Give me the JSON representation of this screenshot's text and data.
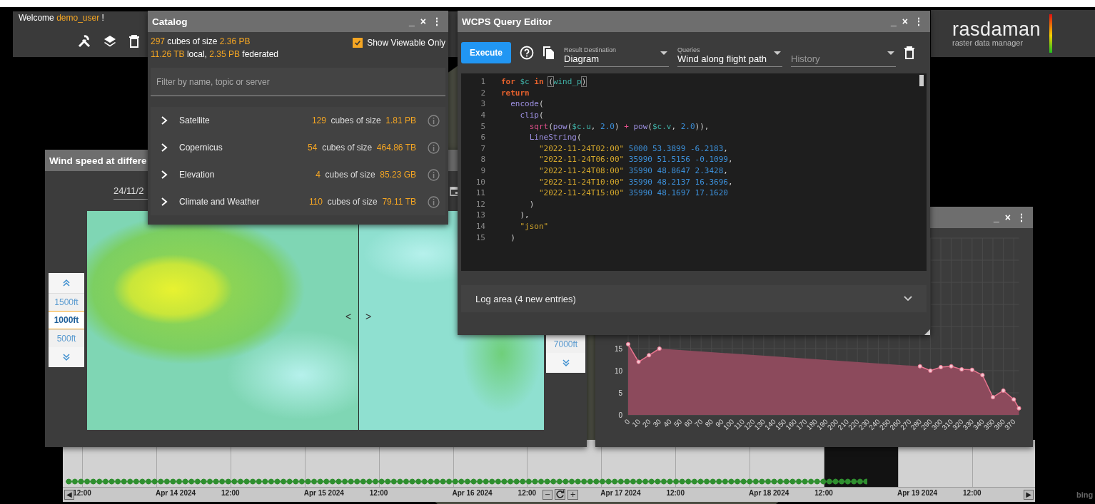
{
  "welcome": {
    "parts": [
      {
        "text": "Welcome ",
        "accent": false
      },
      {
        "text": "demo_user",
        "accent": true
      },
      {
        "text": " !",
        "accent": false
      }
    ]
  },
  "catalog": {
    "title": "Catalog",
    "controls": [
      "_",
      "×",
      "⋮"
    ],
    "stats": [
      {
        "parts": [
          {
            "text": "297",
            "accent": true
          },
          {
            "text": " cubes of size ",
            "accent": false
          },
          {
            "text": "2.36 PB",
            "accent": true
          }
        ]
      },
      {
        "parts": [
          {
            "text": "11.26 TB",
            "accent": true
          },
          {
            "text": " local, ",
            "accent": false
          },
          {
            "text": "2.35 PB",
            "accent": true
          },
          {
            "text": " federated",
            "accent": false
          }
        ]
      }
    ],
    "viewable_checkbox": {
      "label": "Show Viewable Only",
      "checked": true
    },
    "filter": {
      "placeholder": "Filter by name, topic or server"
    },
    "categories": [
      {
        "name": "Satellite",
        "count": "129",
        "unit": "cubes of size",
        "size": "1.81 PB",
        "expanded": false
      },
      {
        "name": "Copernicus",
        "count": "54",
        "unit": "cubes of size",
        "size": "464.86 TB",
        "expanded": false
      },
      {
        "name": "Elevation",
        "count": "4",
        "unit": "cubes of size",
        "size": "85.23 GB",
        "expanded": false
      },
      {
        "name": "Climate and Weather",
        "count": "110",
        "unit": "cubes of size",
        "size": "79.11 TB",
        "expanded": false
      }
    ]
  },
  "editor": {
    "title": "WCPS Query Editor",
    "controls": [
      "_",
      "×",
      "⋮"
    ],
    "execute": "Execute",
    "selects": [
      {
        "label": "Result Destination",
        "value": "Diagram"
      },
      {
        "label": "Queries",
        "value": "Wind along flight path"
      },
      {
        "placeholder": "History"
      }
    ],
    "code": [
      {
        "number": "1",
        "tokens": [
          {
            "text": "for",
            "kind": "keyword"
          },
          {
            "text": " $c",
            "kind": "variable"
          },
          {
            "text": " in ",
            "kind": "keyword"
          },
          {
            "text": "(",
            "kind": "bracket"
          },
          {
            "text": "wind_p",
            "kind": "variable"
          },
          {
            "text": ")",
            "kind": "bracket"
          }
        ]
      },
      {
        "number": "2",
        "tokens": [
          {
            "text": "return",
            "kind": "keyword"
          }
        ]
      },
      {
        "number": "3",
        "tokens": [
          {
            "text": "  encode",
            "kind": "function"
          },
          {
            "text": "(",
            "kind": "plain"
          }
        ]
      },
      {
        "number": "4",
        "tokens": [
          {
            "text": "    clip",
            "kind": "function"
          },
          {
            "text": "(",
            "kind": "plain"
          }
        ]
      },
      {
        "number": "5",
        "tokens": [
          {
            "text": "      sqrt",
            "kind": "builtin"
          },
          {
            "text": "(",
            "kind": "plain"
          },
          {
            "text": "pow",
            "kind": "function"
          },
          {
            "text": "(",
            "kind": "plain"
          },
          {
            "text": "$c.u",
            "kind": "variable"
          },
          {
            "text": ", ",
            "kind": "plain"
          },
          {
            "text": "2.0",
            "kind": "number"
          },
          {
            "text": ") ",
            "kind": "plain"
          },
          {
            "text": "+",
            "kind": "builtin"
          },
          {
            "text": " pow",
            "kind": "function"
          },
          {
            "text": "(",
            "kind": "plain"
          },
          {
            "text": "$c.v",
            "kind": "variable"
          },
          {
            "text": ", ",
            "kind": "plain"
          },
          {
            "text": "2.0",
            "kind": "number"
          },
          {
            "text": ")),",
            "kind": "plain"
          }
        ]
      },
      {
        "number": "6",
        "tokens": [
          {
            "text": "      LineString",
            "kind": "function"
          },
          {
            "text": "(",
            "kind": "plain"
          }
        ]
      },
      {
        "number": "7",
        "tokens": [
          {
            "text": "        \"2022-11-24T02:00\"",
            "kind": "string"
          },
          {
            "text": " 5000 53.3899 -6.2183",
            "kind": "number"
          },
          {
            "text": ",",
            "kind": "plain"
          }
        ]
      },
      {
        "number": "8",
        "tokens": [
          {
            "text": "        \"2022-11-24T06:00\"",
            "kind": "string"
          },
          {
            "text": " 35990 51.5156 -0.1099",
            "kind": "number"
          },
          {
            "text": ",",
            "kind": "plain"
          }
        ]
      },
      {
        "number": "9",
        "tokens": [
          {
            "text": "        \"2022-11-24T08:00\"",
            "kind": "string"
          },
          {
            "text": " 35990 48.8647 2.3428",
            "kind": "number"
          },
          {
            "text": ",",
            "kind": "plain"
          }
        ]
      },
      {
        "number": "10",
        "tokens": [
          {
            "text": "        \"2022-11-24T10:00\"",
            "kind": "string"
          },
          {
            "text": " 35990 48.2137 16.3696",
            "kind": "number"
          },
          {
            "text": ",",
            "kind": "plain"
          }
        ]
      },
      {
        "number": "11",
        "tokens": [
          {
            "text": "        \"2022-11-24T15:00\"",
            "kind": "string"
          },
          {
            "text": " 35990 48.1697 17.1620",
            "kind": "number"
          }
        ]
      },
      {
        "number": "12",
        "tokens": [
          {
            "text": "      )",
            "kind": "plain"
          }
        ]
      },
      {
        "number": "13",
        "tokens": [
          {
            "text": "    ),",
            "kind": "plain"
          }
        ]
      },
      {
        "number": "14",
        "tokens": [
          {
            "text": "    \"json\"",
            "kind": "string"
          }
        ]
      },
      {
        "number": "15",
        "tokens": [
          {
            "text": "  )",
            "kind": "plain"
          }
        ]
      }
    ],
    "log_area": "Log area (4 new entries)"
  },
  "wind_window": {
    "title": "Wind speed at differe",
    "date": "24/11/2",
    "map_nav": [
      "<",
      ">"
    ],
    "altitudes_left": [
      {
        "label": "1500ft",
        "selected": false
      },
      {
        "label": "1000ft",
        "selected": true
      },
      {
        "label": "500ft",
        "selected": false
      }
    ],
    "altitudes_right": [
      {
        "label": "7000ft",
        "selected": false
      }
    ]
  },
  "chart_window": {
    "controls": [
      "_",
      "×",
      "⋮"
    ],
    "chart_data": {
      "type": "area",
      "x": [
        0,
        10,
        20,
        30,
        40,
        50,
        60,
        70,
        80,
        90,
        100,
        110,
        120,
        130,
        140,
        150,
        160,
        170,
        180,
        190,
        200,
        210,
        220,
        230,
        240,
        250,
        260,
        270,
        280,
        290,
        300,
        310,
        320,
        330,
        340,
        350,
        360,
        370,
        375
      ],
      "series": [
        {
          "color": "#e8758f",
          "values": [
            16,
            12,
            13.5,
            15,
            null,
            null,
            null,
            null,
            null,
            null,
            null,
            null,
            null,
            null,
            null,
            null,
            null,
            null,
            null,
            null,
            null,
            null,
            null,
            null,
            null,
            null,
            null,
            null,
            11,
            10,
            10.8,
            11,
            10.3,
            10.2,
            9,
            4,
            5.5,
            3.5,
            1.5
          ]
        }
      ],
      "xlim": [
        0,
        375
      ],
      "ylim": [
        0,
        40
      ],
      "yticks": [
        0,
        5,
        10,
        15
      ],
      "grid": true,
      "xticks": [
        0,
        10,
        20,
        30,
        40,
        50,
        60,
        70,
        80,
        90,
        100,
        110,
        120,
        130,
        140,
        150,
        160,
        170,
        180,
        190,
        200,
        210,
        220,
        230,
        240,
        250,
        260,
        270,
        280,
        290,
        300,
        310,
        320,
        330,
        340,
        350,
        360,
        370
      ]
    }
  },
  "timeline": {
    "prev": "◀",
    "next": "▶",
    "labels": [
      "12:00",
      "Apr 14 2024",
      "12:00",
      "Apr 15 2024",
      "12:00",
      "Apr 16 2024",
      "12:00",
      "Apr 17 2024",
      "12:00",
      "Apr 18 2024",
      "12:00",
      "Apr 19 2024",
      "12:00"
    ],
    "zoom_out": "−",
    "zoom_in": "+"
  },
  "logo": {
    "name": "rasdaman",
    "tagline": "raster data manager"
  },
  "map_credit": "bing"
}
